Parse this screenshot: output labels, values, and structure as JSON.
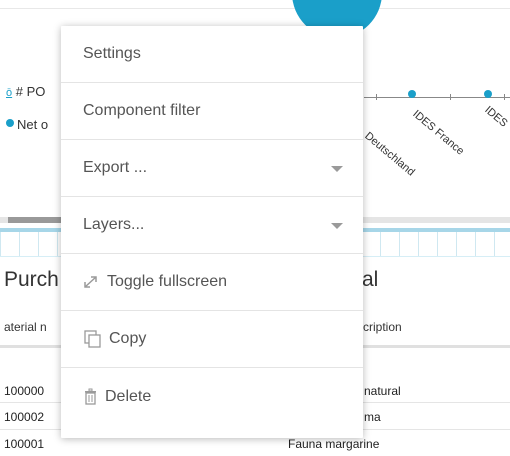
{
  "menu": {
    "items": [
      {
        "label": "Settings",
        "icon": null,
        "submenu": false
      },
      {
        "label": "Component filter",
        "icon": null,
        "submenu": false
      },
      {
        "label": "Export ...",
        "icon": null,
        "submenu": true
      },
      {
        "label": "Layers...",
        "icon": null,
        "submenu": true
      },
      {
        "label": "Toggle fullscreen",
        "icon": "expand-icon",
        "submenu": false
      },
      {
        "label": "Copy",
        "icon": "copy-icon",
        "submenu": false
      },
      {
        "label": "Delete",
        "icon": "trash-icon",
        "submenu": false
      }
    ]
  },
  "chart": {
    "legend_link": "ō",
    "legend_1": "# PO",
    "legend_2": "Net o",
    "x_labels": [
      "Deutschland",
      "IDES France",
      "IDES"
    ],
    "accent": "#1a9fc9"
  },
  "table": {
    "title_left": "Purch",
    "title_right": "al",
    "col_left": "aterial n",
    "col_right": "scription",
    "rows": [
      {
        "material": "100000",
        "description": "natural"
      },
      {
        "material": "100002",
        "description": "ma"
      },
      {
        "material": "100001",
        "description": "Fauna margarine"
      }
    ]
  }
}
